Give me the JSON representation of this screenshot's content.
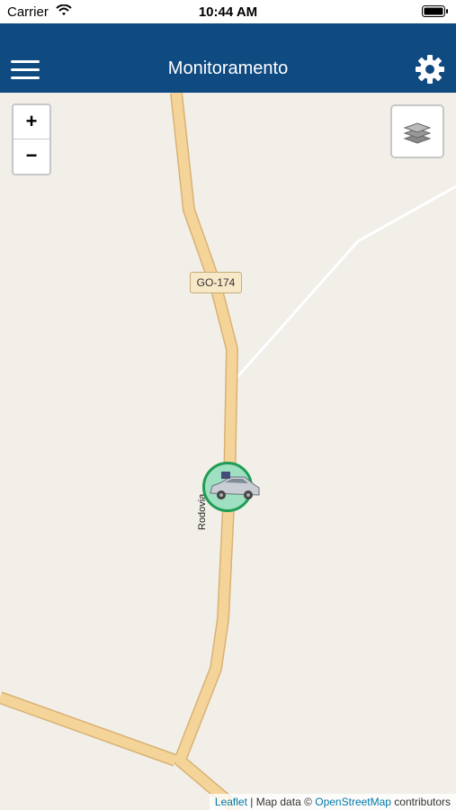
{
  "status": {
    "carrier": "Carrier",
    "time": "10:44 AM"
  },
  "header": {
    "title": "Monitoramento"
  },
  "map": {
    "zoom_in": "+",
    "zoom_out": "−",
    "road_shield": "GO-174",
    "road_name": "Rodovia",
    "vehicle_marker_color": "#1f9d55"
  },
  "attribution": {
    "leaflet": "Leaflet",
    "separator": " | Map data © ",
    "osm": "OpenStreetMap",
    "contributors": " contributors"
  },
  "colors": {
    "navbar": "#0f4a80",
    "map_background": "#f2efe9",
    "road": "#f5d49a"
  }
}
